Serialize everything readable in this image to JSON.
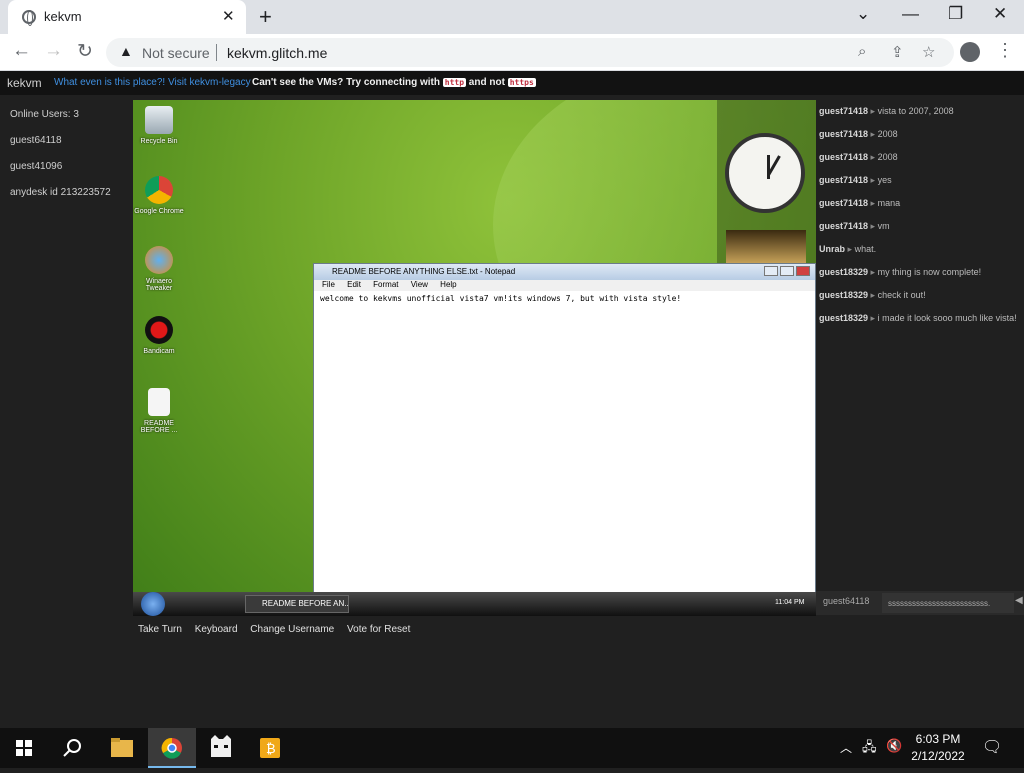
{
  "browser": {
    "tab_title": "kekvm",
    "security_label": "Not secure",
    "url": "kekvm.glitch.me"
  },
  "site": {
    "brand": "kekvm",
    "link_about": "What even is this place?!",
    "link_legacy": "Visit kekvm-legacy",
    "notice_prefix": "Can't see the VMs? Try connecting with",
    "notice_http": "http",
    "notice_and": "and not",
    "notice_https": "https"
  },
  "users": {
    "online": "Online Users: 3",
    "list": [
      "guest64118",
      "guest41096",
      "anydesk id 213223572"
    ]
  },
  "vm": {
    "desktop_icons": [
      "Recycle Bin",
      "Google Chrome",
      "Winaero Tweaker",
      "Bandicam",
      "README BEFORE ..."
    ],
    "notepad_title": "README BEFORE ANYTHING ELSE.txt - Notepad",
    "notepad_menu": [
      "File",
      "Edit",
      "Format",
      "View",
      "Help"
    ],
    "notepad_text": "welcome to kekvms unofficial vista7 vm!its windows 7, but with vista style!",
    "taskbar_task": "README BEFORE AN...",
    "taskbar_time": "11:04 PM"
  },
  "chat": {
    "messages": [
      {
        "user": "guest71418",
        "text": "vista to 2007, 2008"
      },
      {
        "user": "guest71418",
        "text": "2008"
      },
      {
        "user": "guest71418",
        "text": "2008"
      },
      {
        "user": "guest71418",
        "text": "yes"
      },
      {
        "user": "guest71418",
        "text": "mana"
      },
      {
        "user": "guest71418",
        "text": "vm"
      },
      {
        "user": "Unrab",
        "text": "what."
      },
      {
        "user": "guest18329",
        "text": "my thing is now complete!"
      },
      {
        "user": "guest18329",
        "text": "check it out!"
      },
      {
        "user": "guest18329",
        "text": "i made it look sooo much like vista!"
      }
    ],
    "username": "guest64118",
    "input_value": "sssssssssssssssssssssssss."
  },
  "actions": [
    "Take Turn",
    "Keyboard",
    "Change Username",
    "Vote for Reset"
  ],
  "windows": {
    "time": "6:03 PM",
    "date": "2/12/2022"
  }
}
